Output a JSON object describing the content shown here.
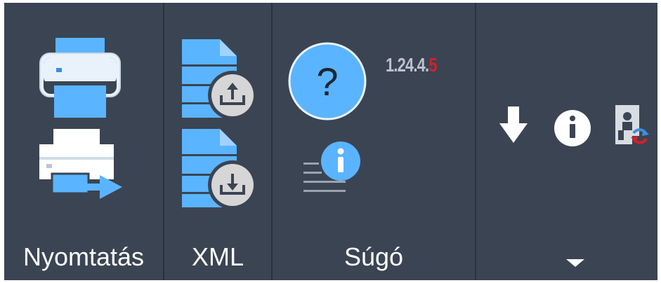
{
  "groups": {
    "print": {
      "label": "Nyomtatás"
    },
    "xml": {
      "label": "XML"
    },
    "help": {
      "label": "Súgó"
    }
  },
  "help": {
    "version_main": "1.24.4.",
    "version_last": "5"
  },
  "icons": {
    "print": "printer-icon",
    "print_export": "printer-export-icon",
    "xml_export": "xml-export-icon",
    "xml_import": "xml-import-icon",
    "help": "help-question-icon",
    "about": "about-info-icon",
    "download": "download-arrow-icon",
    "info": "info-icon",
    "change_user": "change-user-icon",
    "more": "chevron-down-icon"
  },
  "colors": {
    "ribbon_bg": "#3b4453",
    "separator": "#2c323d",
    "icon_blue": "#5ab4ff",
    "icon_blue_dark": "#3e8edc",
    "badge_gray": "#d6d6d6",
    "version_red": "#d4202a"
  }
}
